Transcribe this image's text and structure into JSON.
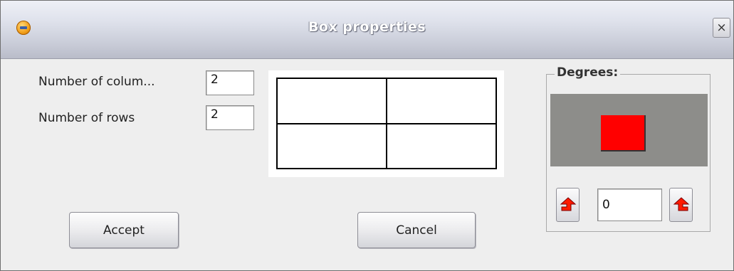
{
  "window": {
    "title": "Box properties",
    "close_label": "×"
  },
  "form": {
    "columns_label": "Number of colum...",
    "columns_value": "2",
    "rows_label": "Number of rows",
    "rows_value": "2"
  },
  "preview": {
    "columns": 2,
    "rows": 2
  },
  "degrees": {
    "title": "Degrees:",
    "value": "0",
    "square_color": "#ff0000",
    "preview_bg": "#8d8d8a",
    "rotate_left_icon": "rotate-left-arrow-icon",
    "rotate_right_icon": "rotate-right-arrow-icon"
  },
  "buttons": {
    "accept": "Accept",
    "cancel": "Cancel"
  }
}
